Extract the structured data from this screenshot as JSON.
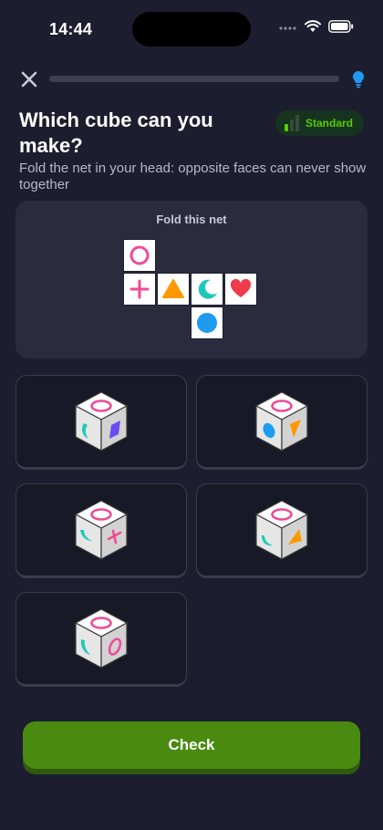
{
  "status_bar": {
    "time": "14:44"
  },
  "progress": {
    "fraction": 0.0
  },
  "question": {
    "title": "Which cube can you make?",
    "subtitle": "Fold the net in your head: opposite faces can never show together",
    "difficulty": "Standard"
  },
  "net": {
    "label": "Fold this net",
    "cells": [
      {
        "symbol": "ring-icon",
        "color": "#ef4b9a"
      },
      {
        "symbol": "plus-icon",
        "color": "#ef4b9a"
      },
      {
        "symbol": "triangle-icon",
        "color": "#ff9800"
      },
      {
        "symbol": "crescent-icon",
        "color": "#1cc9b6"
      },
      {
        "symbol": "heart-icon",
        "color": "#ef3b4b"
      },
      {
        "symbol": "circle-icon",
        "color": "#1e9bf0"
      }
    ]
  },
  "options": [
    {
      "top": "ring-icon",
      "left": "crescent-icon",
      "right": "parallelogram-icon"
    },
    {
      "top": "ring-icon",
      "left": "oval-icon",
      "right": "triangle-icon"
    },
    {
      "top": "ring-icon",
      "left": "crescent-icon",
      "right": "plus-icon"
    },
    {
      "top": "ring-icon",
      "left": "crescent-icon",
      "right": "triangle-icon"
    },
    {
      "top": "ring-icon",
      "left": "crescent-icon",
      "right": "ring-icon"
    }
  ],
  "actions": {
    "check_label": "Check"
  },
  "colors": {
    "background": "#1c1d2e",
    "accent_green": "#58cc02",
    "button_green": "#4a8a10",
    "pink": "#ef4b9a",
    "orange": "#ff9800",
    "teal": "#1cc9b6",
    "red": "#ef3b4b",
    "blue": "#1e9bf0",
    "purple": "#6b4cf0"
  }
}
